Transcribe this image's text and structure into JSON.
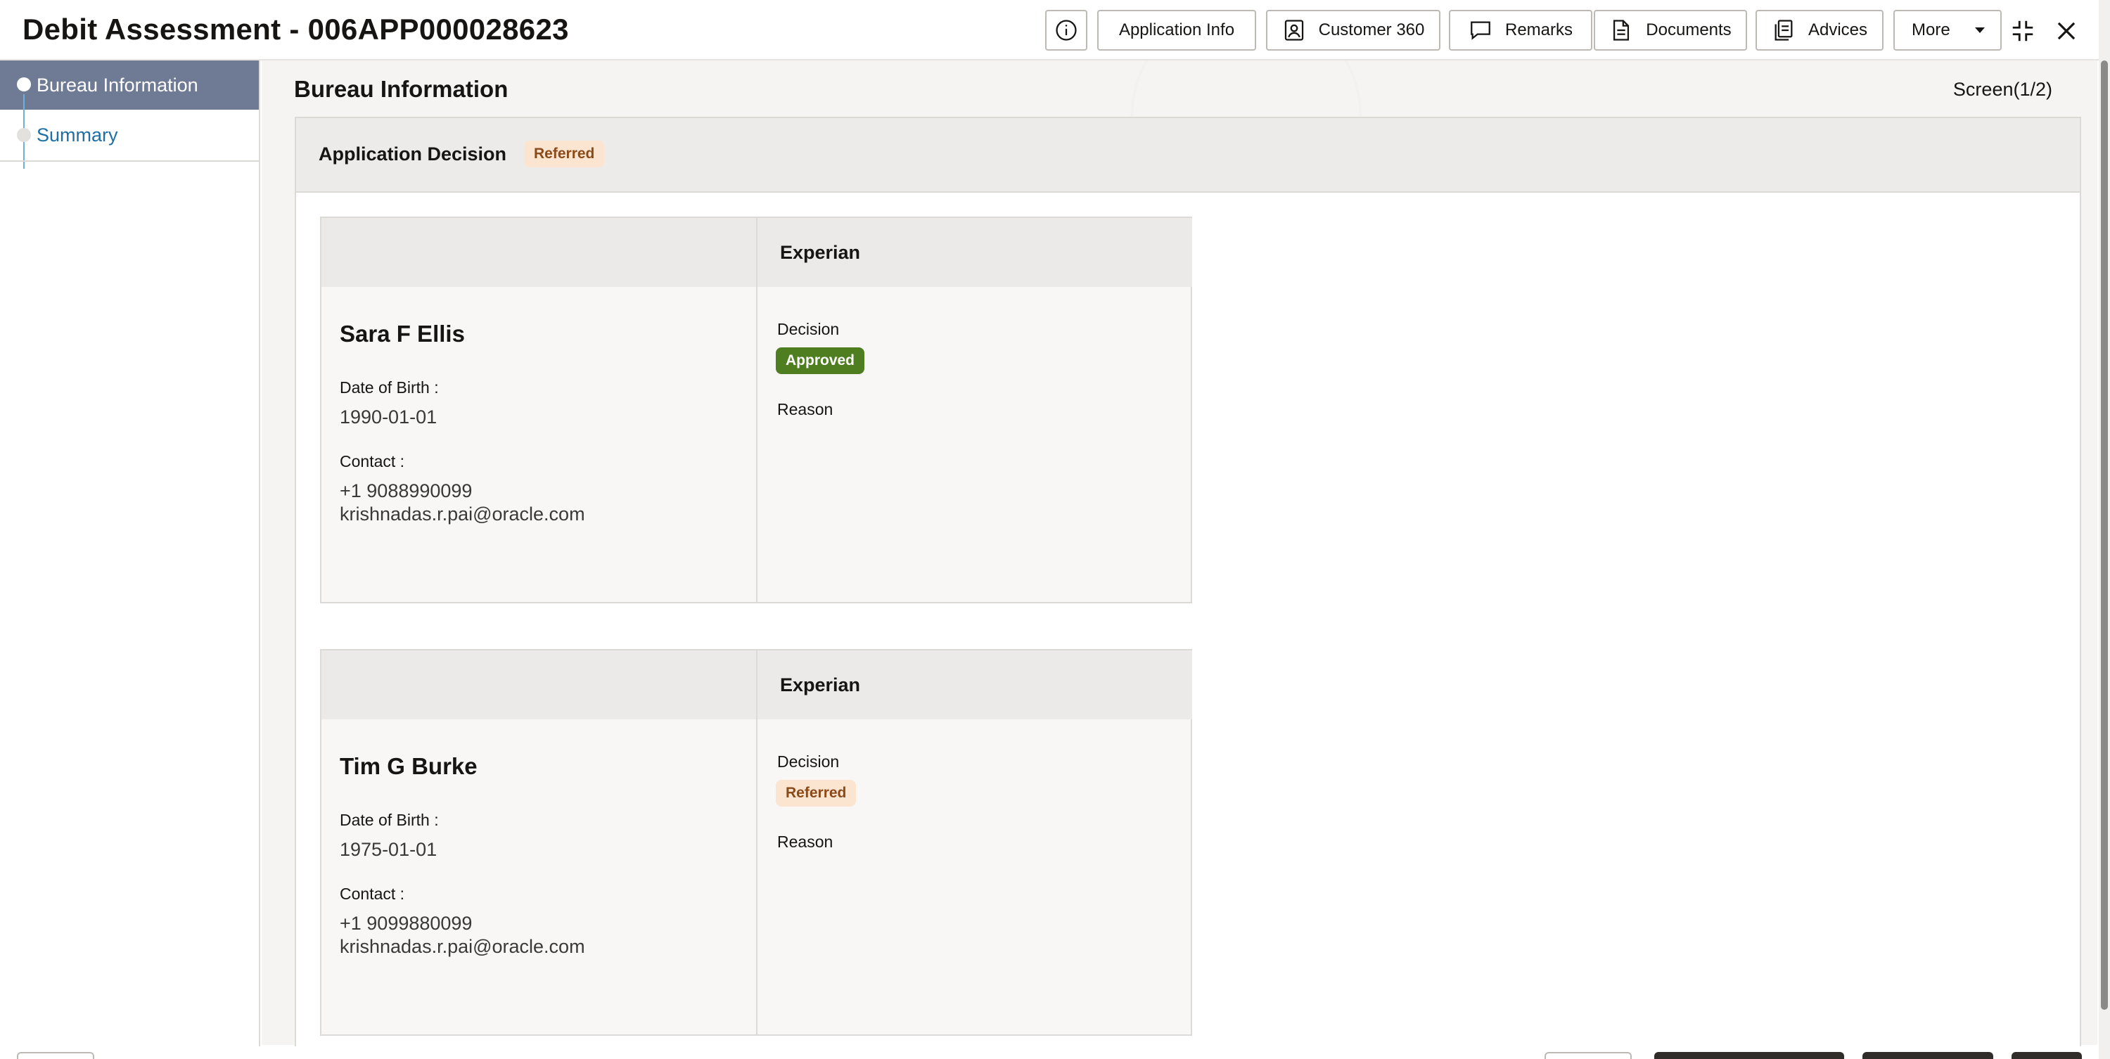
{
  "header": {
    "title": "Debit Assessment - 006APP000028623",
    "buttons": {
      "application_info": "Application Info",
      "customer_360": "Customer 360",
      "remarks": "Remarks",
      "documents": "Documents",
      "advices": "Advices",
      "more": "More"
    },
    "icons": [
      "info-icon",
      "person-card-icon",
      "chat-bubble-icon",
      "document-icon",
      "stacked-documents-icon",
      "caret-down-icon",
      "collapse-icon",
      "close-icon"
    ]
  },
  "sidebar": {
    "items": [
      {
        "label": "Bureau Information",
        "active": true
      },
      {
        "label": "Summary",
        "active": false
      }
    ]
  },
  "main": {
    "section_title": "Bureau Information",
    "screen_indicator": "Screen(1/2)",
    "application_decision": {
      "label": "Application Decision",
      "status": "Referred"
    },
    "applicants": [
      {
        "name": "Sara F Ellis",
        "dob_label": "Date of Birth :",
        "dob": "1990-01-01",
        "contact_label": "Contact :",
        "phone": "+1 9088990099",
        "email": "krishnadas.r.pai@oracle.com",
        "bureau": "Experian",
        "decision_label": "Decision",
        "decision": "Approved",
        "reason_label": "Reason"
      },
      {
        "name": "Tim G Burke",
        "dob_label": "Date of Birth :",
        "dob": "1975-01-01",
        "contact_label": "Contact :",
        "phone": "+1 9099880099",
        "email": "krishnadas.r.pai@oracle.com",
        "bureau": "Experian",
        "decision_label": "Decision",
        "decision": "Referred",
        "reason_label": "Reason"
      }
    ]
  },
  "colors": {
    "sidebar_active_bg": "#6f7a95",
    "link_blue": "#1f6fa5",
    "approved_badge": "#4f7e21",
    "referred_badge_bg": "#fbe5d1",
    "referred_badge_text": "#8a4a1a"
  }
}
